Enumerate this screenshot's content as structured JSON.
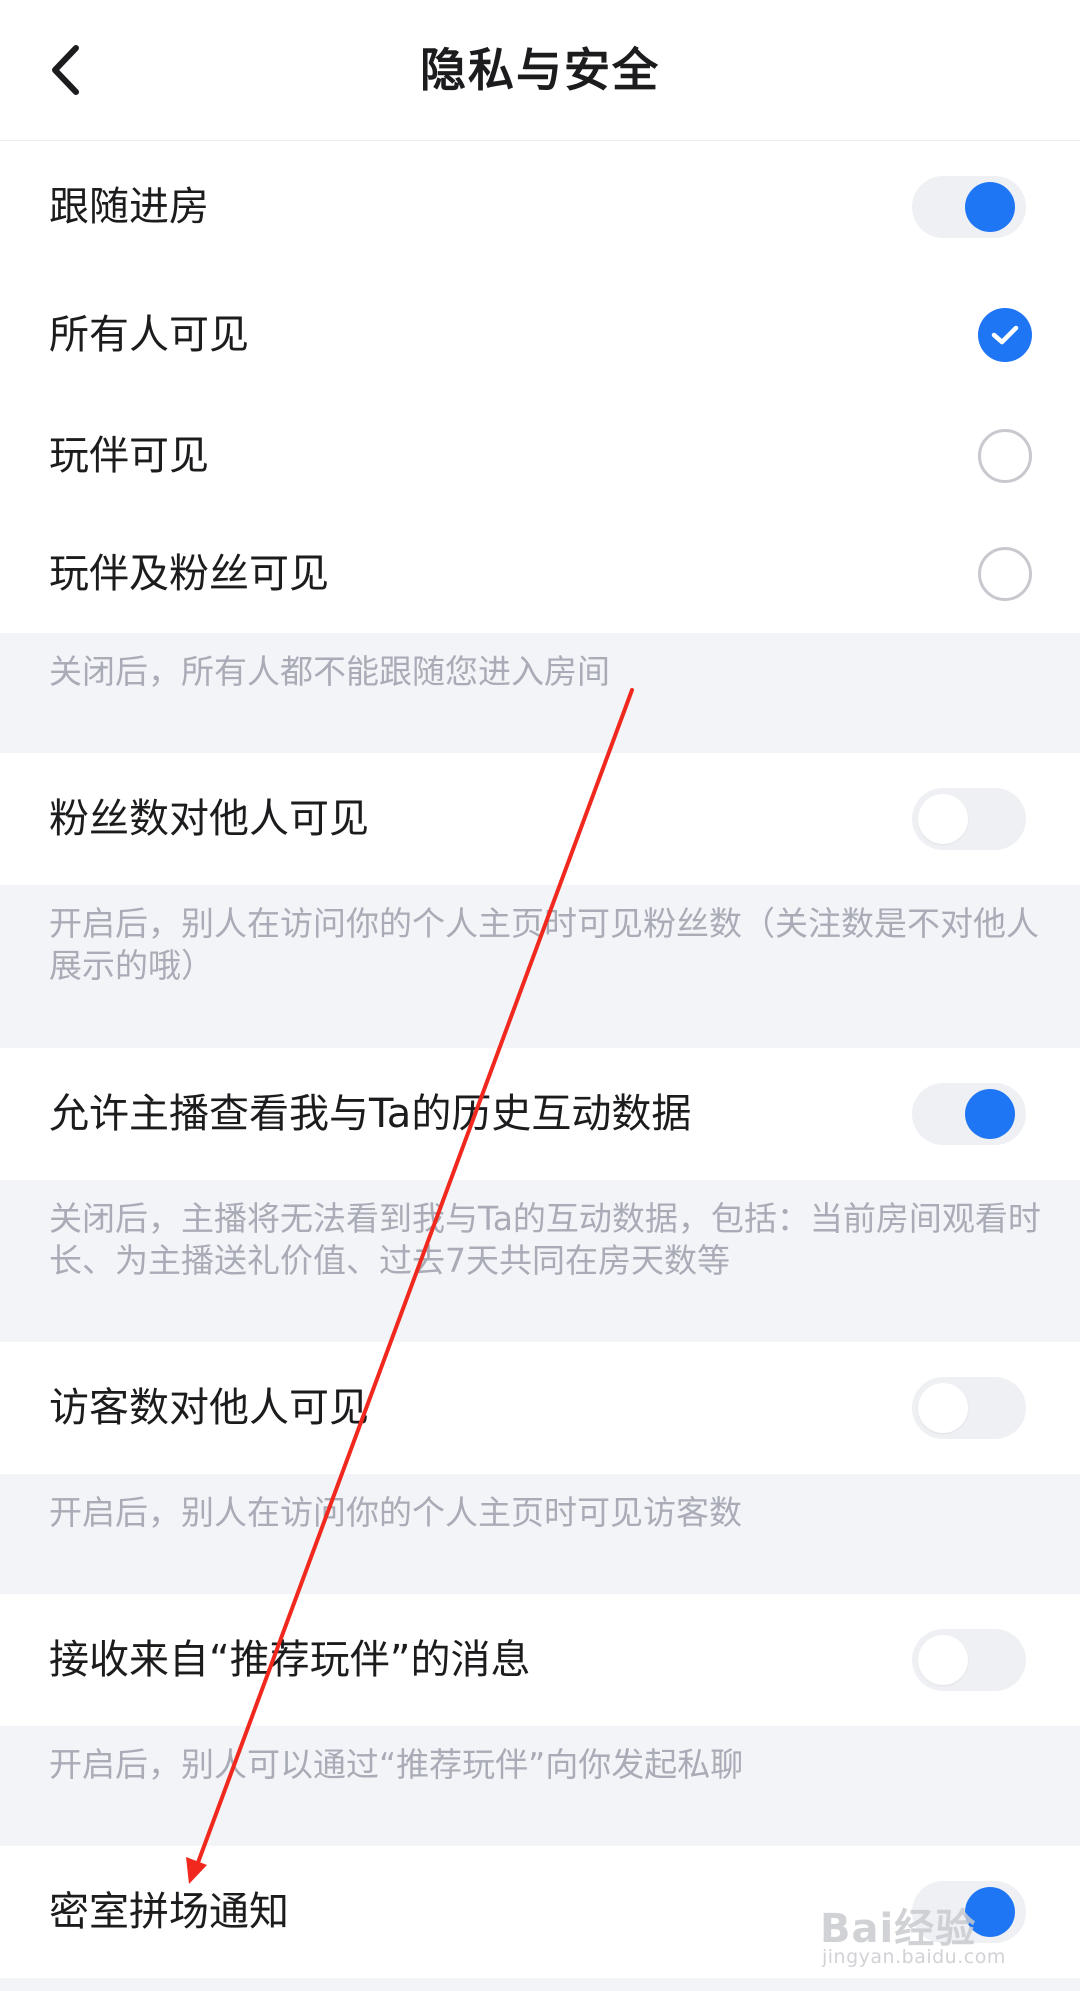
{
  "header": {
    "title": "隐私与安全",
    "back_icon": "chevron-left-icon"
  },
  "follow_room": {
    "label": "跟随进房",
    "enabled": true,
    "options": [
      {
        "label": "所有人可见",
        "checked": true
      },
      {
        "label": "玩伴可见",
        "checked": false
      },
      {
        "label": "玩伴及粉丝可见",
        "checked": false
      }
    ],
    "note": "关闭后，所有人都不能跟随您进入房间"
  },
  "fans_visible": {
    "label": "粉丝数对他人可见",
    "enabled": false,
    "note": "开启后，别人在访问你的个人主页时可见粉丝数（关注数是不对他人展示的哦）"
  },
  "host_history": {
    "label": "允许主播查看我与Ta的历史互动数据",
    "enabled": true,
    "note": "关闭后，主播将无法看到我与Ta的互动数据，包括：当前房间观看时长、为主播送礼价值、过去7天共同在房天数等"
  },
  "visitors_visible": {
    "label": "访客数对他人可见",
    "enabled": false,
    "note": "开启后，别人在访问你的个人主页时可见访客数"
  },
  "recommend_msgs": {
    "label": "接收来自“推荐玩伴”的消息",
    "enabled": false,
    "note": "开启后，别人可以通过“推荐玩伴”向你发起私聊"
  },
  "secret_room": {
    "label": "密室拼场通知",
    "enabled": true
  },
  "watermark": {
    "logo": "Bai经验",
    "url": "jingyan.baidu.com"
  },
  "colors": {
    "accent": "#1f76f5",
    "note_bg": "#f3f4f8",
    "note_text": "#a9acb6",
    "annotation_arrow": "#f0281e"
  }
}
